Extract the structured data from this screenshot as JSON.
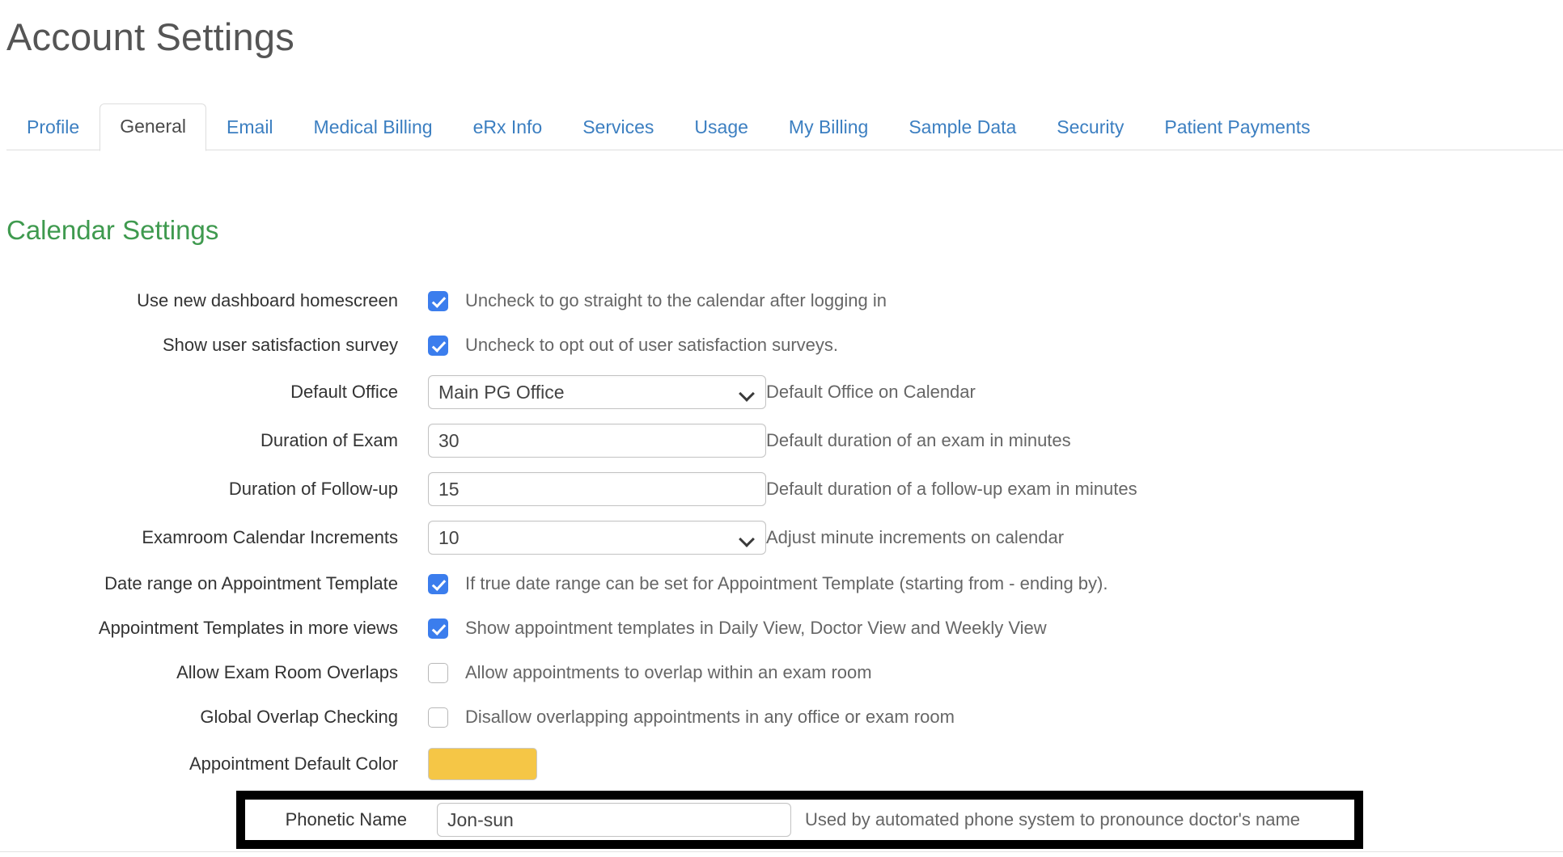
{
  "page": {
    "title": "Account Settings"
  },
  "tabs": [
    {
      "label": "Profile",
      "active": false
    },
    {
      "label": "General",
      "active": true
    },
    {
      "label": "Email",
      "active": false
    },
    {
      "label": "Medical Billing",
      "active": false
    },
    {
      "label": "eRx Info",
      "active": false
    },
    {
      "label": "Services",
      "active": false
    },
    {
      "label": "Usage",
      "active": false
    },
    {
      "label": "My Billing",
      "active": false
    },
    {
      "label": "Sample Data",
      "active": false
    },
    {
      "label": "Security",
      "active": false
    },
    {
      "label": "Patient Payments",
      "active": false
    }
  ],
  "section": {
    "heading": "Calendar Settings",
    "heading_color": "#3f9a4f"
  },
  "colors": {
    "accent_link": "#3c7fc1",
    "checkbox_checked": "#3b7ded",
    "appointment_default_color": "#f5c646",
    "highlight_border": "#000000"
  },
  "rows": {
    "dashboard_homescreen": {
      "label": "Use new dashboard homescreen",
      "checked": true,
      "help": "Uncheck to go straight to the calendar after logging in"
    },
    "satisfaction_survey": {
      "label": "Show user satisfaction survey",
      "checked": true,
      "help": "Uncheck to opt out of user satisfaction surveys."
    },
    "default_office": {
      "label": "Default Office",
      "value": "Main PG Office",
      "help": "Default Office on Calendar"
    },
    "duration_exam": {
      "label": "Duration of Exam",
      "value": "30",
      "help": "Default duration of an exam in minutes"
    },
    "duration_followup": {
      "label": "Duration of Follow-up",
      "value": "15",
      "help": "Default duration of a follow-up exam in minutes"
    },
    "examroom_increments": {
      "label": "Examroom Calendar Increments",
      "value": "10",
      "help": "Adjust minute increments on calendar"
    },
    "date_range_template": {
      "label": "Date range on Appointment Template",
      "checked": true,
      "help": "If true date range can be set for Appointment Template (starting from - ending by)."
    },
    "templates_more_views": {
      "label": "Appointment Templates in more views",
      "checked": true,
      "help": "Show appointment templates in Daily View, Doctor View and Weekly View"
    },
    "exam_room_overlaps": {
      "label": "Allow Exam Room Overlaps",
      "checked": false,
      "help": "Allow appointments to overlap within an exam room"
    },
    "global_overlap": {
      "label": "Global Overlap Checking",
      "checked": false,
      "help": "Disallow overlapping appointments in any office or exam room"
    },
    "appointment_color": {
      "label": "Appointment Default Color",
      "value": "#f5c646"
    },
    "phonetic_name": {
      "label": "Phonetic Name",
      "value": "Jon-sun",
      "help": "Used by automated phone system to pronounce doctor's name"
    }
  }
}
